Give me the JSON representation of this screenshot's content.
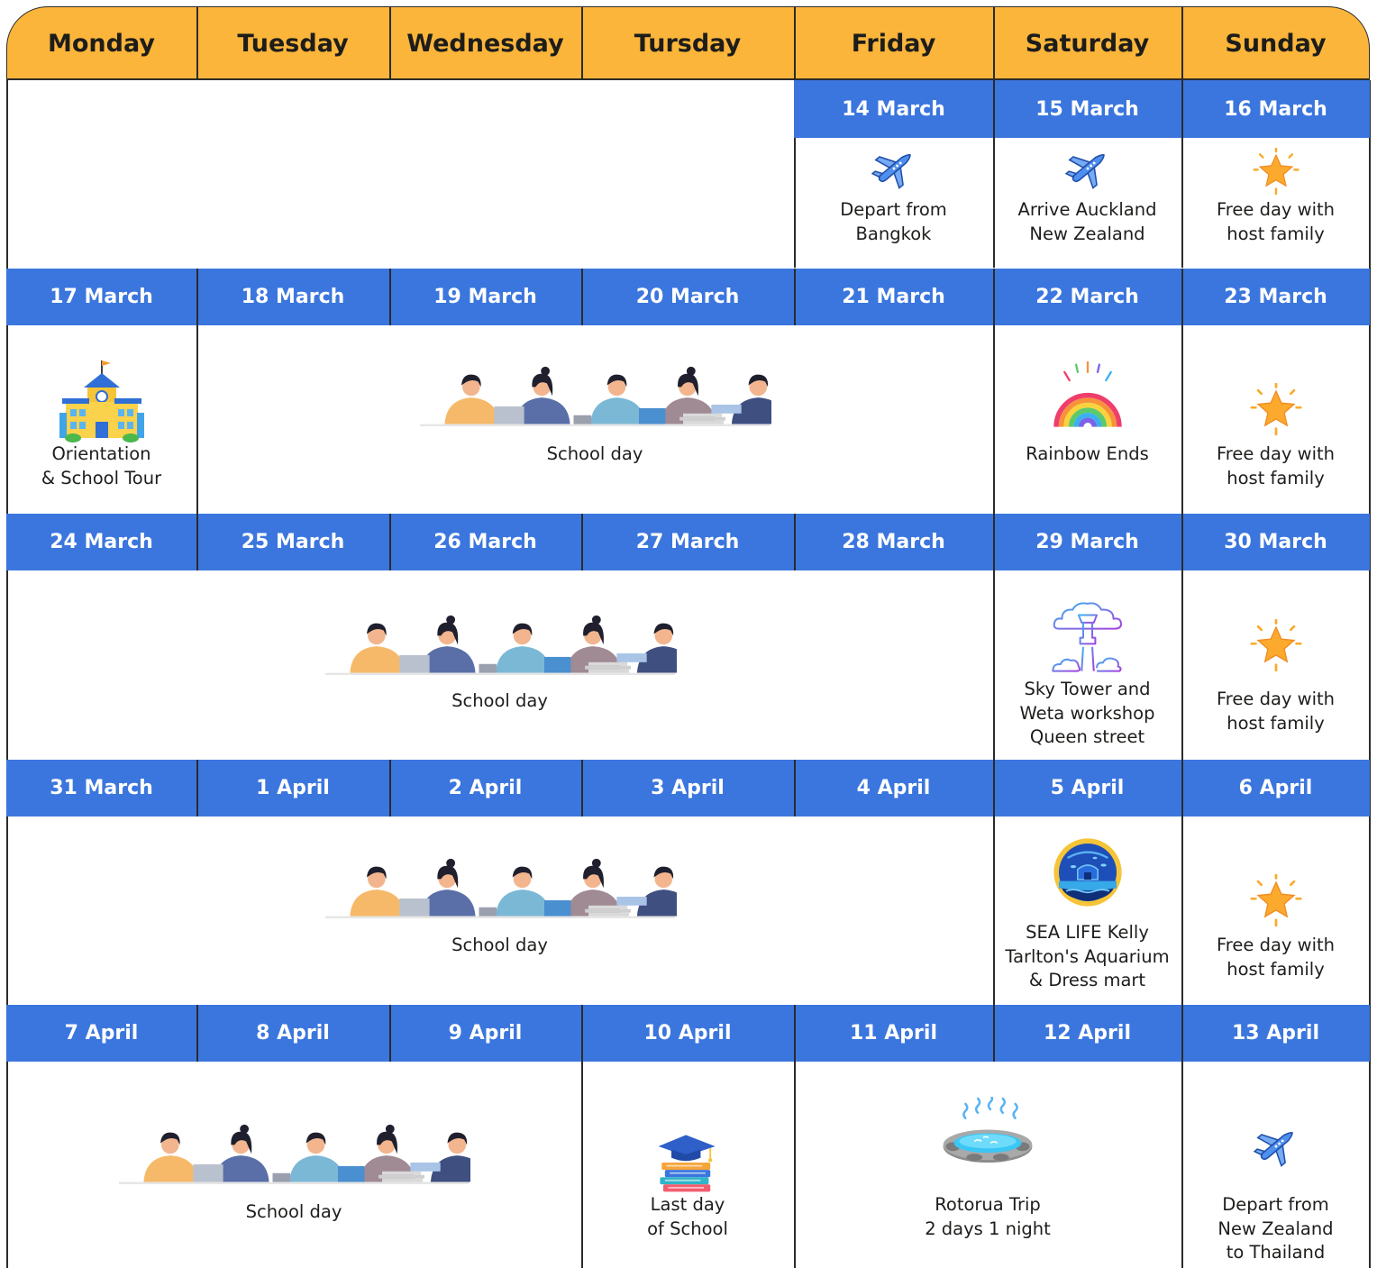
{
  "colors": {
    "header": "#FBB53A",
    "date_band": "#3B76DE",
    "border": "#2b2b2b",
    "cell": "#ffffff"
  },
  "weekdays": [
    "Monday",
    "Tuesday",
    "Wednesday",
    "Tursday",
    "Friday",
    "Saturday",
    "Sunday"
  ],
  "weeks": [
    {
      "dates": [
        "",
        "",
        "",
        "",
        "14 March",
        "15 March",
        "16 March"
      ],
      "events": [
        {
          "label": "Depart from\nBangkok",
          "icon": "airplane-icon"
        },
        {
          "label": "Arrive Auckland\nNew Zealand",
          "icon": "airplane-icon"
        },
        {
          "label": "Free day with\nhost family",
          "icon": "star-icon"
        }
      ]
    },
    {
      "dates": [
        "17 March",
        "18 March",
        "19 March",
        "20 March",
        "21 March",
        "22 March",
        "23 March"
      ],
      "events": [
        {
          "label": "Orientation\n& School Tour",
          "icon": "school-building-icon"
        },
        {
          "label": "School day",
          "icon": "students-illustration"
        },
        {
          "label": "Rainbow Ends",
          "icon": "rainbow-icon"
        },
        {
          "label": "Free day with\nhost family",
          "icon": "star-icon"
        }
      ]
    },
    {
      "dates": [
        "24 March",
        "25 March",
        "26 March",
        "27 March",
        "28 March",
        "29 March",
        "30 March"
      ],
      "events": [
        {
          "label": "School day",
          "icon": "students-illustration"
        },
        {
          "label": "Sky Tower and\nWeta workshop\nQueen street",
          "icon": "sky-tower-icon"
        },
        {
          "label": "Free day with\nhost family",
          "icon": "star-icon"
        }
      ]
    },
    {
      "dates": [
        "31 March",
        "1 April",
        "2 April",
        "3 April",
        "4 April",
        "5 April",
        "6 April"
      ],
      "events": [
        {
          "label": "School day",
          "icon": "students-illustration"
        },
        {
          "label": "SEA LIFE Kelly\nTarlton's Aquarium\n& Dress mart",
          "icon": "aquarium-icon"
        },
        {
          "label": "Free day with\nhost family",
          "icon": "star-icon"
        }
      ]
    },
    {
      "dates": [
        "7 April",
        "8 April",
        "9 April",
        "10 April",
        "11 April",
        "12 April",
        "13 April"
      ],
      "events": [
        {
          "label": "School day",
          "icon": "students-illustration"
        },
        {
          "label": "Last day\nof School",
          "icon": "graduation-books-icon"
        },
        {
          "label": "Rotorua Trip\n2 days 1 night",
          "icon": "hot-spring-icon"
        },
        {
          "label": "Depart from\nNew Zealand\nto Thailand",
          "icon": "airplane-icon"
        }
      ]
    }
  ]
}
